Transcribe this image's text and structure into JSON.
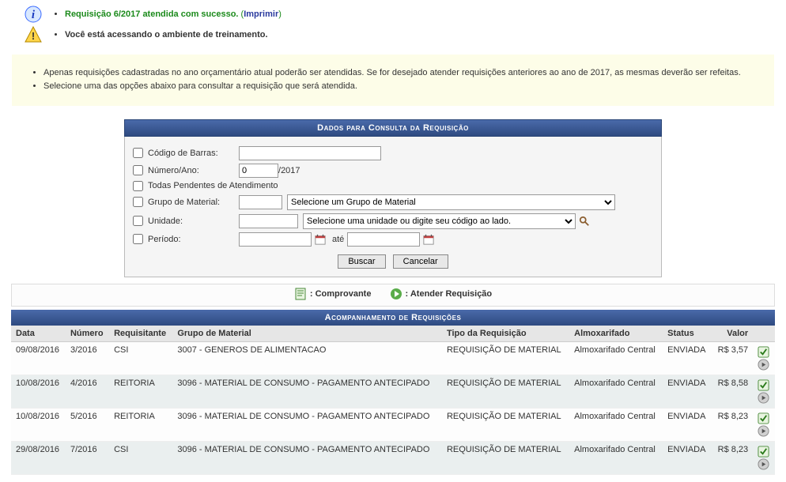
{
  "messages": {
    "success": "Requisição 6/2017 atendida com sucesso.",
    "print_label": "Imprimir",
    "warning": "Você está acessando o ambiente de treinamento."
  },
  "info": {
    "line1": "Apenas requisições cadastradas no ano orçamentário atual poderão ser atendidas. Se for desejado atender requisições anteriores ao ano de 2017, as mesmas deverão ser refeitas.",
    "line2": "Selecione uma das opções abaixo para consultar a requisição que será atendida."
  },
  "form": {
    "title": "Dados para Consulta da Requisição",
    "fields": {
      "barcode": {
        "label": "Código de Barras:",
        "value": ""
      },
      "number_year": {
        "label": "Número/Ano:",
        "number": "0",
        "sep": " /",
        "year": "2017"
      },
      "all_pending": {
        "label": "Todas Pendentes de Atendimento"
      },
      "material_group": {
        "label": "Grupo de Material:",
        "code": "",
        "select_placeholder": "Selecione um Grupo de Material"
      },
      "unit": {
        "label": "Unidade:",
        "code": "",
        "select_placeholder": "Selecione uma unidade ou digite seu código ao lado."
      },
      "period": {
        "label": "Período:",
        "from": "",
        "sep": "até",
        "to": ""
      }
    },
    "buttons": {
      "search": "Buscar",
      "cancel": "Cancelar"
    }
  },
  "legend": {
    "comprovante": ": Comprovante",
    "atender": ": Atender Requisição"
  },
  "table": {
    "title": "Acompanhamento de Requisições",
    "headers": {
      "data": "Data",
      "numero": "Número",
      "requisitante": "Requisitante",
      "grupo": "Grupo de Material",
      "tipo": "Tipo da Requisição",
      "almox": "Almoxarifado",
      "status": "Status",
      "valor": "Valor"
    },
    "rows": [
      {
        "data": "09/08/2016",
        "numero": "3/2016",
        "requisitante": "CSI",
        "grupo": "3007 - GENEROS DE ALIMENTACAO",
        "tipo": "REQUISIÇÃO DE MATERIAL",
        "almox": "Almoxarifado Central",
        "status": "ENVIADA",
        "valor": "R$ 3,57"
      },
      {
        "data": "10/08/2016",
        "numero": "4/2016",
        "requisitante": "REITORIA",
        "grupo": "3096 - MATERIAL DE CONSUMO - PAGAMENTO ANTECIPADO",
        "tipo": "REQUISIÇÃO DE MATERIAL",
        "almox": "Almoxarifado Central",
        "status": "ENVIADA",
        "valor": "R$ 8,58"
      },
      {
        "data": "10/08/2016",
        "numero": "5/2016",
        "requisitante": "REITORIA",
        "grupo": "3096 - MATERIAL DE CONSUMO - PAGAMENTO ANTECIPADO",
        "tipo": "REQUISIÇÃO DE MATERIAL",
        "almox": "Almoxarifado Central",
        "status": "ENVIADA",
        "valor": "R$ 8,23"
      },
      {
        "data": "29/08/2016",
        "numero": "7/2016",
        "requisitante": "CSI",
        "grupo": "3096 - MATERIAL DE CONSUMO - PAGAMENTO ANTECIPADO",
        "tipo": "REQUISIÇÃO DE MATERIAL",
        "almox": "Almoxarifado Central",
        "status": "ENVIADA",
        "valor": "R$ 8,23"
      }
    ]
  }
}
